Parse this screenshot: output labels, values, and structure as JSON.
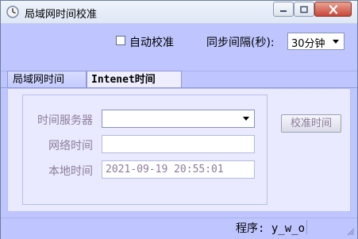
{
  "window": {
    "title": "局域网时间校准"
  },
  "titlebar": {
    "controls": [
      "minimize",
      "maximize",
      "close"
    ]
  },
  "toolbar": {
    "auto_sync_label": "自动校准",
    "auto_sync_checked": false,
    "interval_label": "同步间隔(秒):",
    "interval_value": "30分钟"
  },
  "tabs": [
    {
      "label": "局域网时间",
      "active": false
    },
    {
      "label": "Intenet时间",
      "active": true
    }
  ],
  "internet_tab": {
    "server_label": "时间服务器",
    "server_value": "",
    "network_time_label": "网络时间",
    "network_time_value": "",
    "local_time_label": "本地时间",
    "local_time_value": "2021-09-19 20:55:01",
    "sync_button_label": "校准时间"
  },
  "statusbar": {
    "text": "程序: y_w_o"
  },
  "colors": {
    "window_bg": "#bfc6ff",
    "panel_bg": "#e9eaff",
    "muted_text": "#8d7b9b"
  }
}
